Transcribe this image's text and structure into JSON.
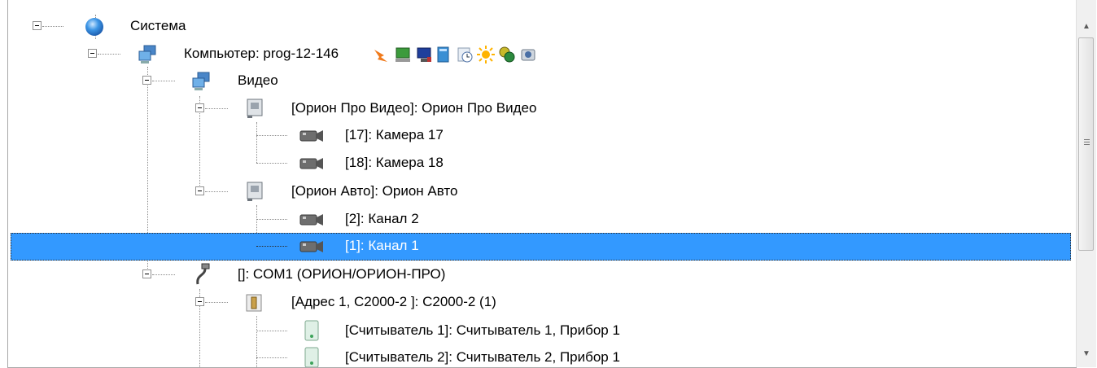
{
  "tree": {
    "rows": [
      {
        "label": "Система"
      },
      {
        "label": "Компьютер: prog-12-146"
      },
      {
        "label": "Видео"
      },
      {
        "label": "[Орион Про Видео]: Орион Про Видео"
      },
      {
        "label": "[17]: Камера 17"
      },
      {
        "label": "[18]: Камера 18"
      },
      {
        "label": "[Орион Авто]: Орион Авто"
      },
      {
        "label": "[2]: Канал 2"
      },
      {
        "label": "[1]: Канал 1"
      },
      {
        "label": "[]: COM1 (ОРИОН/ОРИОН-ПРО)"
      },
      {
        "label": "[Адрес 1, С2000-2 ]: С2000-2 (1)"
      },
      {
        "label": "[Считыватель 1]: Считыватель 1, Прибор 1"
      },
      {
        "label": "[Считыватель 2]: Считыватель 2, Прибор 1"
      }
    ],
    "selected_row": "[1]: Канал 1"
  },
  "colors": {
    "selection": "#3399ff",
    "selection_text": "#ffffff"
  },
  "icons": {
    "toolbar": [
      "arrow-icon",
      "monitor-green-icon",
      "monitor-blue-icon",
      "book-icon",
      "clock-icon",
      "sun-icon",
      "gear-group-icon",
      "disk-icon"
    ]
  }
}
